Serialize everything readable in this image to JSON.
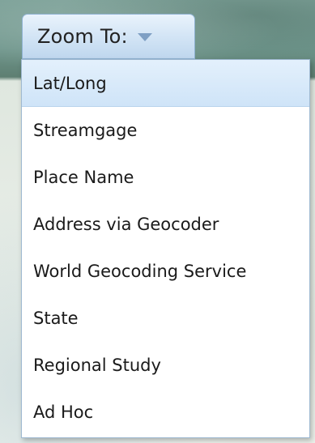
{
  "zoom_to": {
    "label": "Zoom To:",
    "caret_icon": "caret-down-icon"
  },
  "menu": {
    "items": [
      {
        "label": "Lat/Long",
        "selected": true
      },
      {
        "label": "Streamgage"
      },
      {
        "label": "Place Name"
      },
      {
        "label": "Address via Geocoder"
      },
      {
        "label": "World Geocoding Service"
      },
      {
        "label": "State"
      },
      {
        "label": "Regional Study"
      },
      {
        "label": "Ad Hoc"
      }
    ]
  },
  "colors": {
    "button_gradient_top": "#e9f3fc",
    "button_gradient_bottom": "#bfd7ee",
    "selected_item": "#d6e8fa",
    "menu_border": "#9fb9d1"
  }
}
